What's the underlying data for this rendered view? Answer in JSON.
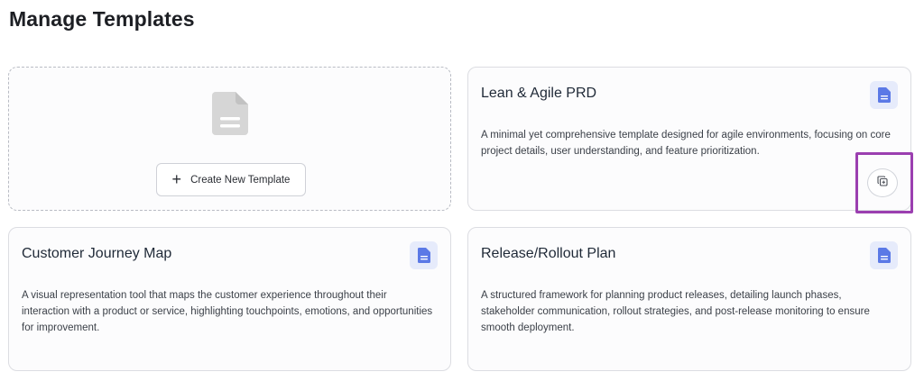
{
  "page": {
    "title": "Manage Templates"
  },
  "new_template": {
    "icon": "document-icon",
    "button_label": "Create New Template",
    "button_icon": "plus-icon"
  },
  "templates": [
    {
      "title": "Lean & Agile PRD",
      "description": "A minimal yet comprehensive template designed for agile environments, focusing on core project details, user understanding, and feature prioritization.",
      "icon": "document-icon",
      "action_icon": "duplicate-icon"
    },
    {
      "title": "Customer Journey Map",
      "description": "A visual representation tool that maps the customer experience throughout their interaction with a product or service, highlighting touchpoints, emotions, and opportunities for improvement.",
      "icon": "document-icon"
    },
    {
      "title": "Release/Rollout Plan",
      "description": "A structured framework for planning product releases, detailing launch phases, stakeholder communication, rollout strategies, and post-release monitoring to ensure smooth deployment.",
      "icon": "document-icon"
    }
  ],
  "colors": {
    "accent_icon": "#5b79e6",
    "accent_icon_bg": "#e6ebfb",
    "highlight": "#9b3fb0",
    "placeholder_icon": "#d6d6d6"
  }
}
